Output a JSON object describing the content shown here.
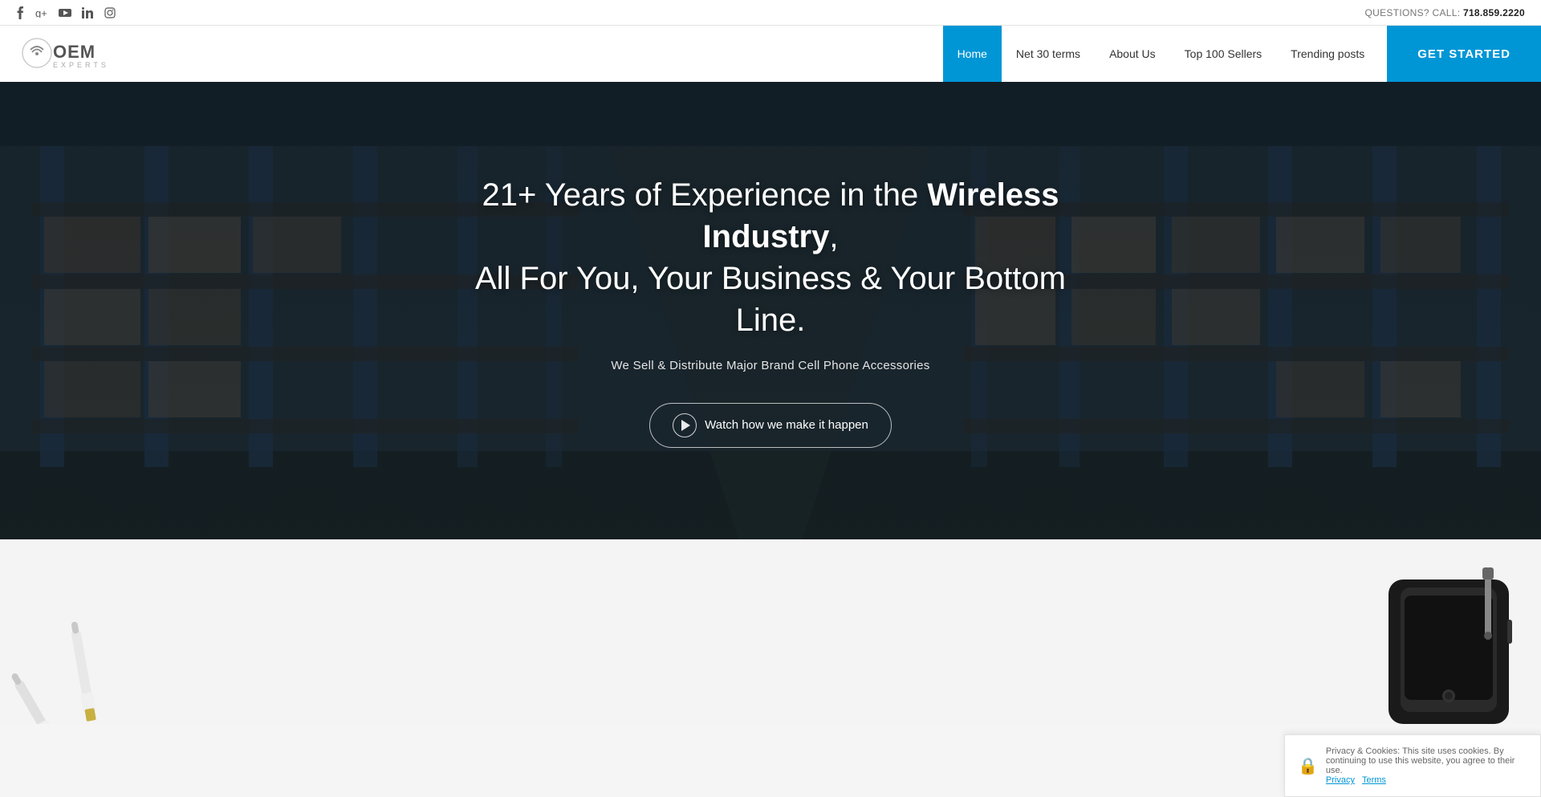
{
  "topbar": {
    "questions_label": "QUESTIONS? CALL:",
    "phone": "718.859.2220",
    "social_icons": [
      "facebook",
      "google-plus",
      "youtube",
      "linkedin",
      "instagram"
    ]
  },
  "header": {
    "logo_text": "OEM EXPERTS",
    "get_started_label": "GET STARTED",
    "nav": [
      {
        "label": "Home",
        "active": true
      },
      {
        "label": "Net 30 terms",
        "active": false
      },
      {
        "label": "About Us",
        "active": false
      },
      {
        "label": "Top 100 Sellers",
        "active": false
      },
      {
        "label": "Trending posts",
        "active": false
      }
    ]
  },
  "hero": {
    "title_normal": "21+ Years of Experience in the",
    "title_bold": "Wireless Industry",
    "title_end": ",",
    "title_line2": "All For You, Your Business & Your Bottom Line.",
    "subtitle": "We Sell & Distribute Major Brand Cell Phone Accessories",
    "watch_btn_label": "Watch how we make it happen"
  },
  "cookie": {
    "text": "Privacy & Cookies: This site uses cookies. By continuing to use this website, you agree to their use.",
    "link_text": "Terms",
    "label_privacy": "Privacy",
    "label_terms": "Terms"
  }
}
